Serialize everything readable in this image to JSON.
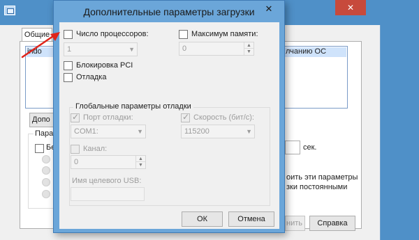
{
  "background_window": {
    "close_label": "✕",
    "tab_label": "Общие",
    "list_item_left": "indo",
    "list_item_right": "лчанию ОС",
    "advanced_button_label": "Допо",
    "params_group_label": "Пара",
    "checkbox_label": "Бе",
    "seconds_label": "сек.",
    "note_line1": "оить эти параметры",
    "note_line2": "зки постоянными",
    "apply_button_label": "нить",
    "help_button_label": "Справка"
  },
  "dialog": {
    "title": "Дополнительные параметры загрузки",
    "close_label": "✕",
    "num_processors": {
      "label": "Число процессоров:",
      "checked": false,
      "value": "1"
    },
    "max_memory": {
      "label": "Максимум памяти:",
      "checked": false,
      "value": "0"
    },
    "pci_lock": {
      "label": "Блокировка PCI",
      "checked": false
    },
    "debug": {
      "label": "Отладка",
      "checked": false
    },
    "debug_group": {
      "title": "Глобальные параметры отладки",
      "debug_port": {
        "label": "Порт отладки:",
        "checked": true,
        "value": "COM1:"
      },
      "baud_rate": {
        "label": "Скорость (бит/с):",
        "checked": true,
        "value": "115200"
      },
      "channel": {
        "label": "Канал:",
        "checked": false,
        "value": "0"
      },
      "usb_target": {
        "label": "Имя целевого USB:",
        "value": ""
      }
    },
    "ok_label": "ОК",
    "cancel_label": "Отмена"
  },
  "colors": {
    "title_bar": "#4f90c8",
    "dialog_frame": "#6ba6d9",
    "close_button": "#c74a3c",
    "annotation_arrow": "#e0241a"
  },
  "icons": {
    "app": "msconfig-window-icon",
    "arrow": "red-annotation-arrow"
  }
}
